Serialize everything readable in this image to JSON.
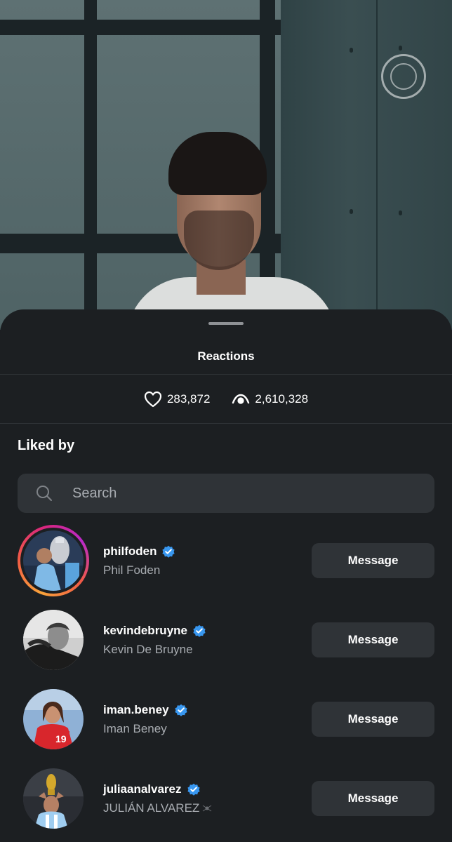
{
  "sheet": {
    "title": "Reactions",
    "likes_count": "283,872",
    "views_count": "2,610,328",
    "section_title": "Liked by",
    "search_placeholder": "Search"
  },
  "icons": {
    "likes": "heart-icon",
    "views": "eye-icon",
    "search": "search-icon",
    "verified": "verified-badge-icon"
  },
  "colors": {
    "sheet_bg": "#1c1f22",
    "button_bg": "#2f3337",
    "verified_blue": "#3897f0",
    "secondary_text": "#a8acb1"
  },
  "users": [
    {
      "username": "philfoden",
      "full_name": "Phil Foden",
      "verified": true,
      "has_story_ring": true,
      "button_label": "Message"
    },
    {
      "username": "kevindebruyne",
      "full_name": "Kevin De Bruyne",
      "verified": true,
      "has_story_ring": false,
      "button_label": "Message"
    },
    {
      "username": "iman.beney",
      "full_name": "Iman Beney",
      "verified": true,
      "has_story_ring": false,
      "button_label": "Message"
    },
    {
      "username": "juliaanalvarez",
      "full_name": "JULIÁN ALVAREZ",
      "verified": true,
      "has_story_ring": false,
      "button_label": "Message"
    }
  ]
}
